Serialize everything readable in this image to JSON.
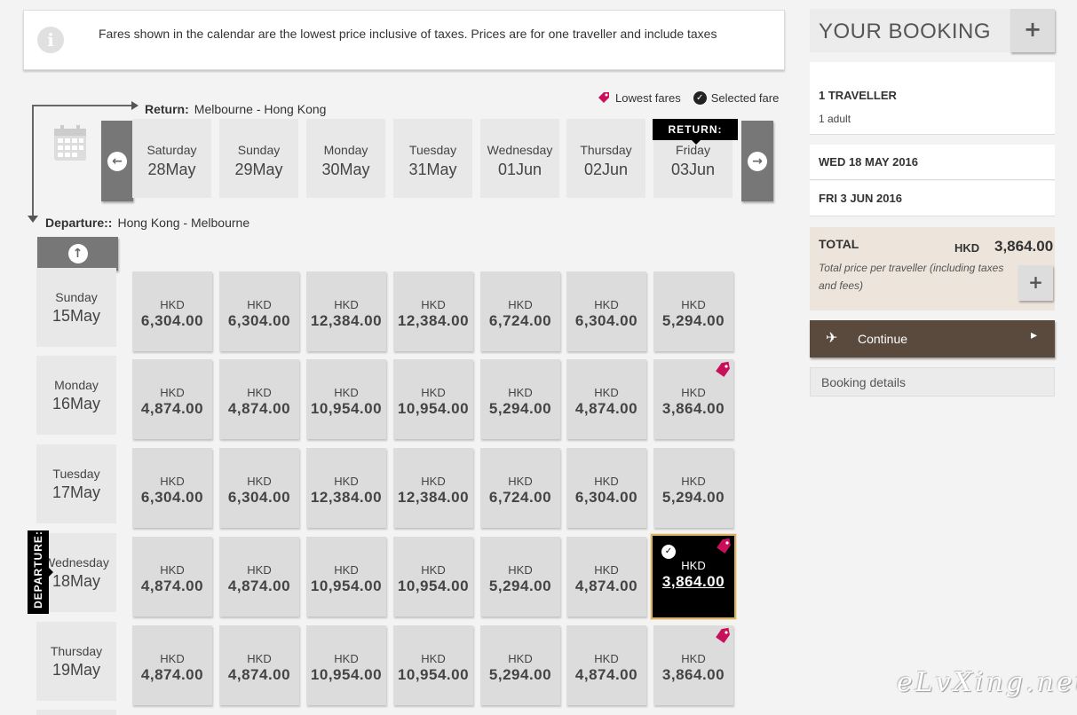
{
  "info": {
    "text": "Fares shown in the calendar are the lowest price inclusive of taxes. Prices are for one traveller and include taxes",
    "icon": "info-icon"
  },
  "legend": {
    "lowest_label": "Lowest fares",
    "selected_label": "Selected fare",
    "lowest_color": "#c8105a"
  },
  "return_route": {
    "label": "Return:",
    "route": "Melbourne - Hong Kong"
  },
  "departure_route": {
    "label": "Departure::",
    "route": "Hong Kong - Melbourne"
  },
  "return_badge": "RETURN:",
  "departure_badge": "DEPARTURE:",
  "return_days": [
    {
      "day": "Saturday",
      "date": "28May"
    },
    {
      "day": "Sunday",
      "date": "29May"
    },
    {
      "day": "Monday",
      "date": "30May"
    },
    {
      "day": "Tuesday",
      "date": "31May"
    },
    {
      "day": "Wednesday",
      "date": "01Jun"
    },
    {
      "day": "Thursday",
      "date": "02Jun"
    },
    {
      "day": "Friday",
      "date": "03Jun"
    }
  ],
  "departure_days": [
    {
      "day": "Sunday",
      "date": "15May"
    },
    {
      "day": "Monday",
      "date": "16May"
    },
    {
      "day": "Tuesday",
      "date": "17May"
    },
    {
      "day": "Wednesday",
      "date": "18May"
    },
    {
      "day": "Thursday",
      "date": "19May"
    }
  ],
  "currency": "HKD",
  "fares": [
    [
      "6,304.00",
      "6,304.00",
      "12,384.00",
      "12,384.00",
      "6,724.00",
      "6,304.00",
      "5,294.00"
    ],
    [
      "4,874.00",
      "4,874.00",
      "10,954.00",
      "10,954.00",
      "5,294.00",
      "4,874.00",
      "3,864.00"
    ],
    [
      "6,304.00",
      "6,304.00",
      "12,384.00",
      "12,384.00",
      "6,724.00",
      "6,304.00",
      "5,294.00"
    ],
    [
      "4,874.00",
      "4,874.00",
      "10,954.00",
      "10,954.00",
      "5,294.00",
      "4,874.00",
      "3,864.00"
    ],
    [
      "4,874.00",
      "4,874.00",
      "10,954.00",
      "10,954.00",
      "5,294.00",
      "4,874.00",
      "3,864.00"
    ]
  ],
  "lowest_cells": [
    [
      1,
      6
    ],
    [
      3,
      6
    ],
    [
      4,
      6
    ]
  ],
  "selected_cell": [
    3,
    6
  ],
  "booking": {
    "title": "YOUR BOOKING",
    "travellers": "1 TRAVELLER",
    "travellers_detail": "1 adult",
    "outbound_date": "WED 18 MAY 2016",
    "return_date": "FRI 3 JUN 2016",
    "total_label": "TOTAL",
    "total_currency": "HKD",
    "total_value": "3,864.00",
    "total_note": "Total price per traveller (including taxes and fees)",
    "continue_label": "Continue",
    "details_label": "Booking details",
    "continue_color": "#5a4a3e"
  },
  "watermark": "eLvXing.net"
}
